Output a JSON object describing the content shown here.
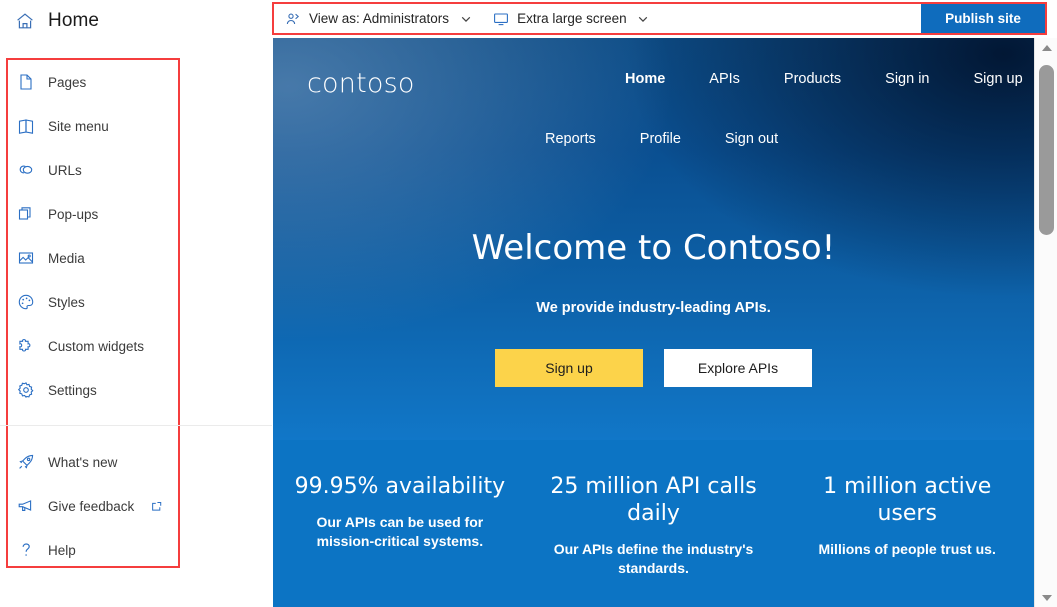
{
  "left_pane": {
    "header": {
      "icon": "home-icon",
      "label": "Home"
    },
    "items": [
      {
        "icon": "page-icon",
        "label": "Pages"
      },
      {
        "icon": "site-menu-icon",
        "label": "Site menu"
      },
      {
        "icon": "urls-icon",
        "label": "URLs"
      },
      {
        "icon": "popups-icon",
        "label": "Pop-ups"
      },
      {
        "icon": "media-icon",
        "label": "Media"
      },
      {
        "icon": "styles-icon",
        "label": "Styles"
      },
      {
        "icon": "custom-widgets-icon",
        "label": "Custom widgets"
      },
      {
        "icon": "settings-icon",
        "label": "Settings"
      }
    ],
    "bottom_items": [
      {
        "icon": "rocket-icon",
        "label": "What's new",
        "external": false
      },
      {
        "icon": "megaphone-icon",
        "label": "Give feedback",
        "external": true
      },
      {
        "icon": "question-icon",
        "label": "Help",
        "external": false
      }
    ],
    "highlight_color": "#f53d3d"
  },
  "toolbar": {
    "view_as": {
      "icon": "people-icon",
      "label": "View as: Administrators",
      "chevron": "chevron-down-icon"
    },
    "screen_size": {
      "icon": "monitor-icon",
      "label": "Extra large screen",
      "chevron": "chevron-down-icon"
    },
    "publish_label": "Publish site",
    "publish_color": "#0f6cbd",
    "highlight_color": "#f53d3d"
  },
  "preview": {
    "logo": "contoso",
    "nav_row_1": [
      {
        "label": "Home",
        "active": true
      },
      {
        "label": "APIs",
        "active": false
      },
      {
        "label": "Products",
        "active": false
      },
      {
        "label": "Sign in",
        "active": false
      },
      {
        "label": "Sign up",
        "active": false
      }
    ],
    "nav_row_2": [
      {
        "label": "Reports",
        "active": false
      },
      {
        "label": "Profile",
        "active": false
      },
      {
        "label": "Sign out",
        "active": false
      }
    ],
    "hero": {
      "title": "Welcome to Contoso!",
      "subtitle": "We provide industry-leading APIs.",
      "cta_primary": "Sign up",
      "cta_secondary": "Explore APIs",
      "primary_color": "#fcd34a",
      "secondary_color": "#ffffff"
    },
    "stats_band_color": "#0c74c4",
    "stats": [
      {
        "headline": "99.95% availability",
        "body": "Our APIs can be used for mission-critical systems."
      },
      {
        "headline": "25 million API calls daily",
        "body": "Our APIs define the industry's standards."
      },
      {
        "headline": "1 million active users",
        "body": "Millions of people trust us."
      }
    ]
  },
  "scrollbar": {
    "up": "scroll-up-arrow-icon",
    "down": "scroll-down-arrow-icon",
    "thumb": "scrollbar-thumb"
  }
}
